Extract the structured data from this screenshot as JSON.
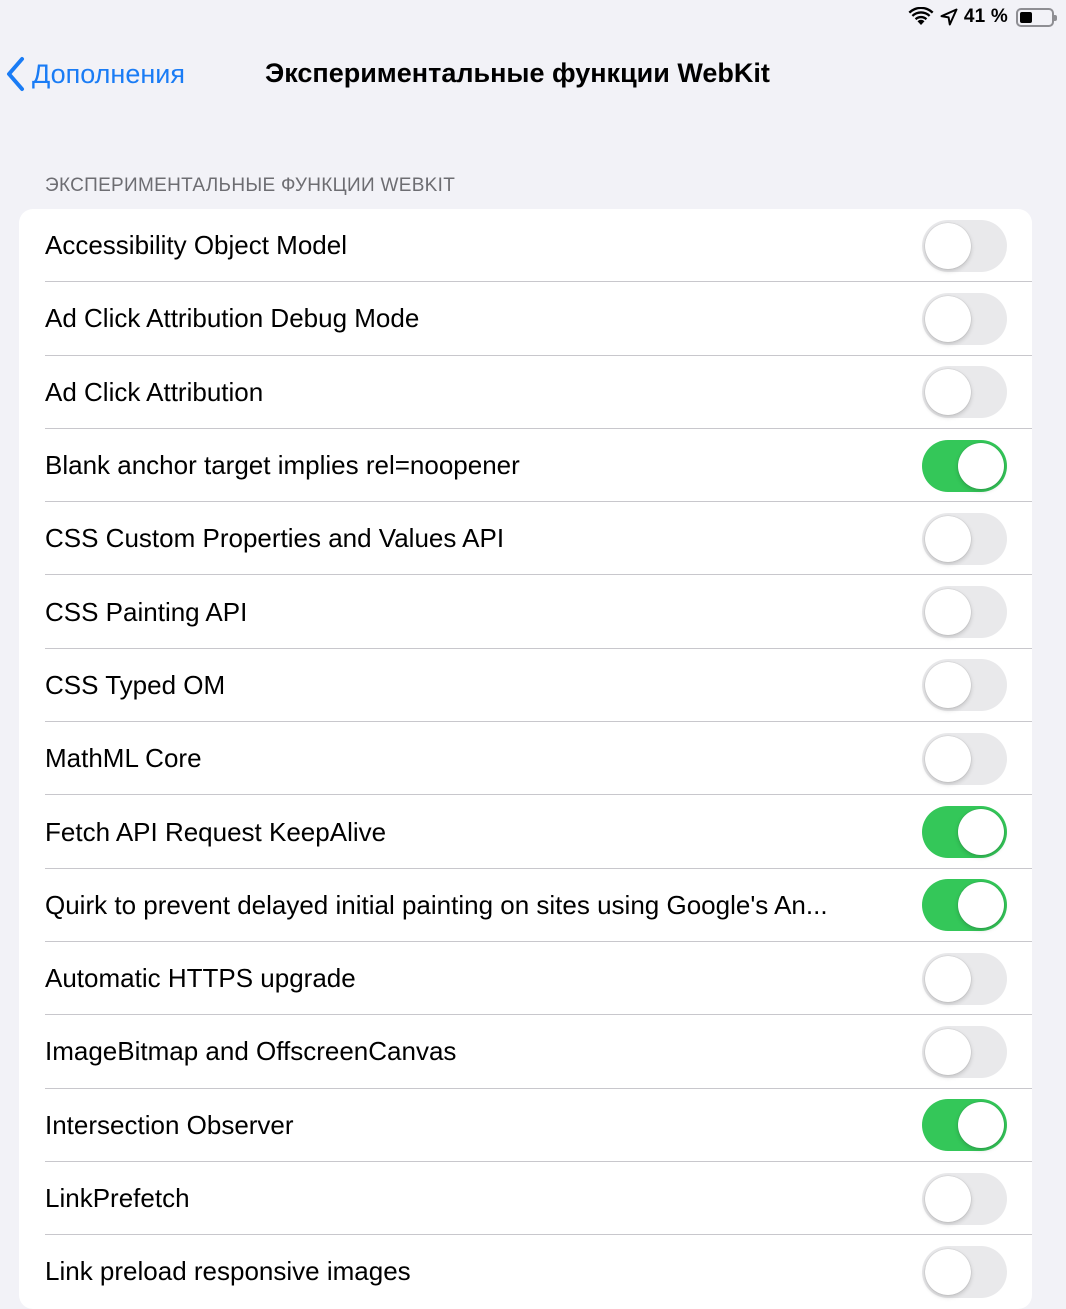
{
  "status_bar": {
    "battery_percent_text": "41 %",
    "battery_level": 0.41,
    "icons": [
      "wifi-icon",
      "location-arrow-icon",
      "battery-icon"
    ]
  },
  "nav": {
    "back_label": "Дополнения",
    "title": "Экспериментальные функции WebKit"
  },
  "section": {
    "header": "ЭКСПЕРИМЕНТАЛЬНЫЕ ФУНКЦИИ WEBKIT"
  },
  "colors": {
    "accent": "#1a7cf5",
    "toggle_on": "#34c759",
    "toggle_off": "#e9e9eb",
    "background": "#f2f2f7"
  },
  "rows": [
    {
      "label": "Accessibility Object Model",
      "on": false
    },
    {
      "label": "Ad Click Attribution Debug Mode",
      "on": false
    },
    {
      "label": "Ad Click Attribution",
      "on": false
    },
    {
      "label": "Blank anchor target implies rel=noopener",
      "on": true
    },
    {
      "label": "CSS Custom Properties and Values API",
      "on": false
    },
    {
      "label": "CSS Painting API",
      "on": false
    },
    {
      "label": "CSS Typed OM",
      "on": false
    },
    {
      "label": "MathML Core",
      "on": false
    },
    {
      "label": "Fetch API Request KeepAlive",
      "on": true
    },
    {
      "label": "Quirk to prevent delayed initial painting on sites using Google's An...",
      "on": true
    },
    {
      "label": "Automatic HTTPS upgrade",
      "on": false
    },
    {
      "label": "ImageBitmap and OffscreenCanvas",
      "on": false
    },
    {
      "label": "Intersection Observer",
      "on": true
    },
    {
      "label": "LinkPrefetch",
      "on": false
    },
    {
      "label": "Link preload responsive images",
      "on": false
    }
  ]
}
